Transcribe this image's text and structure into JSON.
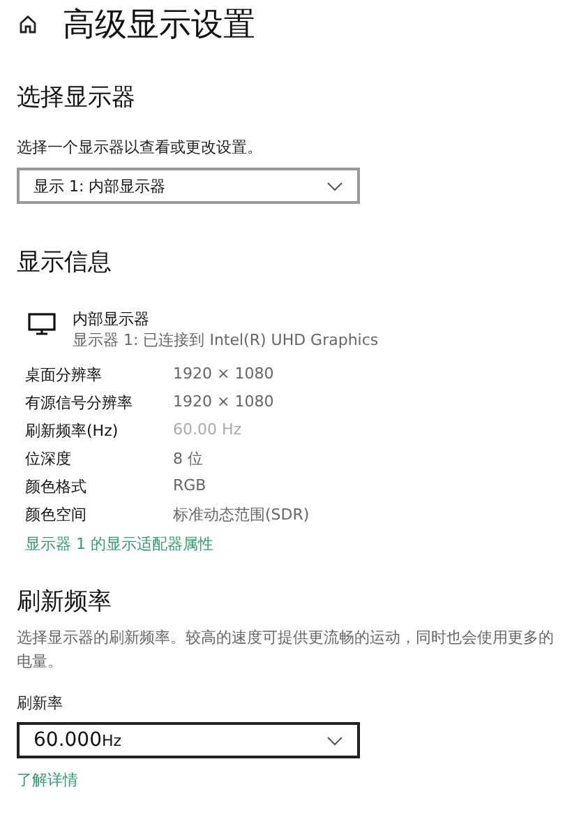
{
  "page": {
    "title": "高级显示设置"
  },
  "select_display": {
    "heading": "选择显示器",
    "description": "选择一个显示器以查看或更改设置。",
    "dropdown": {
      "value": "显示 1: 内部显示器",
      "active": false
    }
  },
  "display_info": {
    "heading": "显示信息",
    "monitor": {
      "name": "内部显示器",
      "detail": "显示器 1: 已连接到 Intel(R) UHD Graphics"
    },
    "rows": [
      {
        "label": "桌面分辨率",
        "value": "1920 × 1080",
        "dimmed": false
      },
      {
        "label": "有源信号分辨率",
        "value": "1920 × 1080",
        "dimmed": false
      },
      {
        "label": "刷新频率(Hz)",
        "value": "60.00 Hz",
        "dimmed": true
      },
      {
        "label": "位深度",
        "value": "8 位",
        "dimmed": false
      },
      {
        "label": "颜色格式",
        "value": "RGB",
        "dimmed": false
      },
      {
        "label": "颜色空间",
        "value": "标准动态范围(SDR)",
        "dimmed": false
      }
    ],
    "link": "显示器 1 的显示适配器属性"
  },
  "refresh_rate": {
    "heading": "刷新频率",
    "description": "选择显示器的刷新频率。较高的速度可提供更流畅的运动，同时也会使用更多的电量。",
    "label": "刷新率",
    "dropdown": {
      "value": "60.000",
      "unit": "Hz",
      "active": true
    },
    "link": "了解详情"
  }
}
